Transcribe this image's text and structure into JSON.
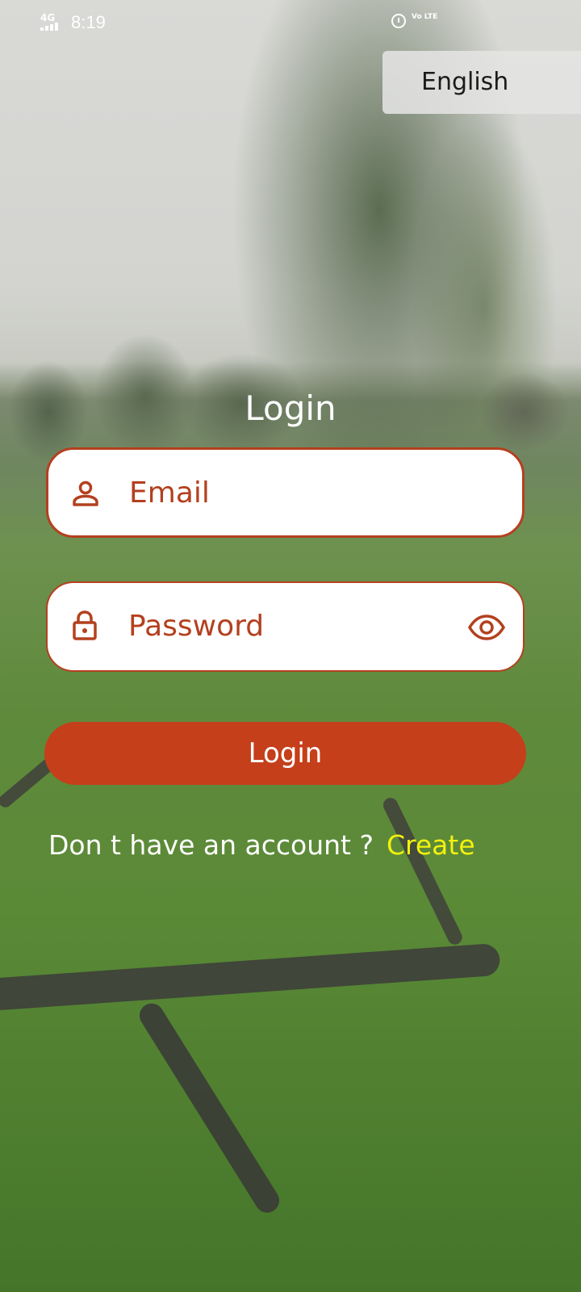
{
  "status_bar": {
    "network": "4G",
    "time": "8:19",
    "volte": "Vo LTE"
  },
  "language_button": {
    "label": "English"
  },
  "login_form": {
    "title": "Login",
    "email_placeholder": "Email",
    "password_placeholder": "Password",
    "submit_label": "Login",
    "no_account_text": "Don t have an account ?",
    "create_link": "Create"
  },
  "icons": {
    "user": "person-icon",
    "lock": "lock-icon",
    "visibility": "eye-icon",
    "alarm": "alarm-icon"
  },
  "colors": {
    "accent": "#c53f1a",
    "field_text": "#b4401f",
    "link": "#f4f10f"
  }
}
